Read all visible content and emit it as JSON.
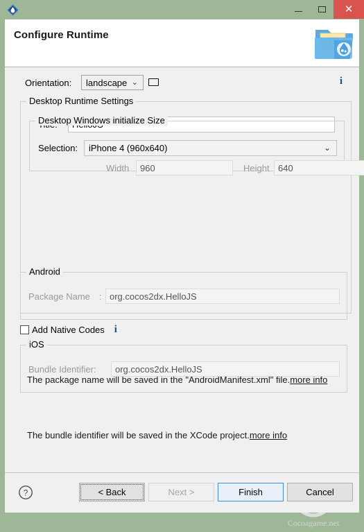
{
  "window": {
    "minimize_label": "minimize",
    "maximize_label": "maximize",
    "close_label": "✕"
  },
  "header": {
    "title": "Configure Runtime",
    "icon_label": "JS"
  },
  "form": {
    "orientation": {
      "label": "Orientation:",
      "value": "landscape",
      "chevron": "⌄",
      "info": "i"
    },
    "desktop_group": {
      "legend": "Desktop Runtime Settings",
      "title_label": "Title:",
      "title_value": "HelloJS",
      "size_group": {
        "legend": "Desktop Windows initialize Size",
        "selection_label": "Selection:",
        "selection_value": "iPhone 4 (960x640)",
        "chevron": "⌄",
        "width_label": "Width",
        "width_value": "960",
        "height_label": "Height",
        "height_value": "640"
      }
    },
    "native": {
      "checkbox_label": "Add Native Codes",
      "checked": false,
      "info": "i"
    },
    "android": {
      "legend": "Android",
      "package_label": "Package Name :",
      "package_value": "org.cocos2dx.HelloJS",
      "hint_text": "The package name will be saved in the \"AndroidManifest.xml\" file.",
      "hint_link": "more info"
    },
    "ios": {
      "legend": "iOS",
      "bundle_label": "Bundle Identifier:",
      "bundle_value": "org.cocos2dx.HelloJS",
      "hint_text": "The bundle identifier will be saved in the XCode project.",
      "hint_link": "more info"
    }
  },
  "watermark": {
    "text": "Cocoagame.net"
  },
  "footer": {
    "help_label": "?",
    "buttons": [
      {
        "label": "< Back",
        "underline": "B",
        "state": "focused"
      },
      {
        "label": "Next >",
        "underline": "N",
        "state": "disabled"
      },
      {
        "label": "Finish",
        "underline": "F",
        "state": "default"
      },
      {
        "label": "Cancel",
        "underline": "",
        "state": "normal"
      }
    ]
  },
  "colors": {
    "titlebar": "#9eb897",
    "close": "#d9534f",
    "accent_info": "#14538a",
    "default_button_border": "#3c8ddb"
  }
}
